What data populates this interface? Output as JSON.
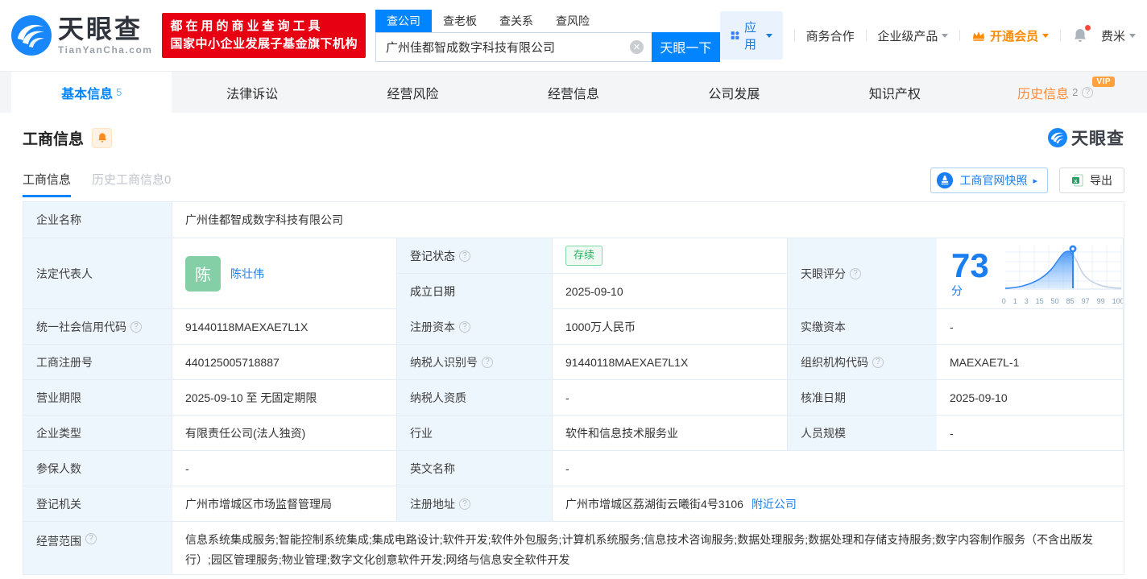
{
  "colors": {
    "accent_blue": "#0084ff",
    "brand_red": "#e60012",
    "vip_orange": "#ff8a00",
    "status_green": "#27b463",
    "link_blue": "#2080e5",
    "label_cell_bg": "#eef6fd"
  },
  "header": {
    "logo": {
      "cn": "天眼查",
      "domain": "TianYanCha.com"
    },
    "slogan": {
      "line1": "都在用的商业查询工具",
      "line2": "国家中小企业发展子基金旗下机构"
    },
    "search": {
      "tabs": [
        {
          "label": "查公司",
          "active": true
        },
        {
          "label": "查老板",
          "active": false
        },
        {
          "label": "查关系",
          "active": false
        },
        {
          "label": "查风险",
          "active": false
        }
      ],
      "value": "广州佳都智成数字科技有限公司",
      "button": "天眼一下"
    },
    "nav": {
      "apps": "应用",
      "cooperation": "商务合作",
      "enterprise": "企业级产品",
      "vip": "开通会员",
      "username": "费米"
    }
  },
  "tabs": [
    {
      "label": "基本信息",
      "count": "5",
      "active": true
    },
    {
      "label": "法律诉讼"
    },
    {
      "label": "经营风险"
    },
    {
      "label": "经营信息"
    },
    {
      "label": "公司发展"
    },
    {
      "label": "知识产权"
    },
    {
      "label": "历史信息",
      "count": "2",
      "vip_badge": "VIP"
    }
  ],
  "section": {
    "title": "工商信息",
    "watermark": "天眼查",
    "subtabs": [
      {
        "label": "工商信息",
        "active": true
      },
      {
        "label": "历史工商信息0",
        "active": false
      }
    ],
    "snapshot_button": "工商官网快照",
    "export_button": "导出"
  },
  "table": {
    "company_name": {
      "label": "企业名称",
      "value": "广州佳都智成数字科技有限公司"
    },
    "legal_rep": {
      "label": "法定代表人",
      "avatar": "陈",
      "name": "陈壮伟"
    },
    "reg_status": {
      "label": "登记状态",
      "value": "存续"
    },
    "establish_date": {
      "label": "成立日期",
      "value": "2025-09-10"
    },
    "score": {
      "label": "天眼评分",
      "value": "73",
      "unit": "分",
      "chart_ticks": [
        "0",
        "1",
        "3",
        "15",
        "50",
        "85",
        "97",
        "99",
        "100"
      ]
    },
    "credit_code": {
      "label": "统一社会信用代码",
      "value": "91440118MAEXAE7L1X"
    },
    "reg_capital": {
      "label": "注册资本",
      "value": "1000万人民币"
    },
    "paid_capital": {
      "label": "实缴资本",
      "value": "-"
    },
    "reg_number": {
      "label": "工商注册号",
      "value": "440125005718887"
    },
    "taxpayer_id": {
      "label": "纳税人识别号",
      "value": "91440118MAEXAE7L1X"
    },
    "org_code": {
      "label": "组织机构代码",
      "value": "MAEXAE7L-1"
    },
    "business_term": {
      "label": "营业期限",
      "value": "2025-09-10 至 无固定期限"
    },
    "taxpayer_quality": {
      "label": "纳税人资质",
      "value": "-"
    },
    "approval_date": {
      "label": "核准日期",
      "value": "2025-09-10"
    },
    "company_type": {
      "label": "企业类型",
      "value": "有限责任公司(法人独资)"
    },
    "industry": {
      "label": "行业",
      "value": "软件和信息技术服务业"
    },
    "staff_size": {
      "label": "人员规模",
      "value": "-"
    },
    "insured_count": {
      "label": "参保人数",
      "value": "-"
    },
    "english_name": {
      "label": "英文名称",
      "value": "-"
    },
    "reg_authority": {
      "label": "登记机关",
      "value": "广州市增城区市场监督管理局"
    },
    "reg_address": {
      "label": "注册地址",
      "value": "广州市增城区荔湖街云曦街4号3106",
      "link": "附近公司"
    },
    "business_scope": {
      "label": "经营范围",
      "value": "信息系统集成服务;智能控制系统集成;集成电路设计;软件开发;软件外包服务;计算机系统服务;信息技术咨询服务;数据处理服务;数据处理和存储支持服务;数字内容制作服务（不含出版发行）;园区管理服务;物业管理;数字文化创意软件开发;网络与信息安全软件开发"
    }
  }
}
